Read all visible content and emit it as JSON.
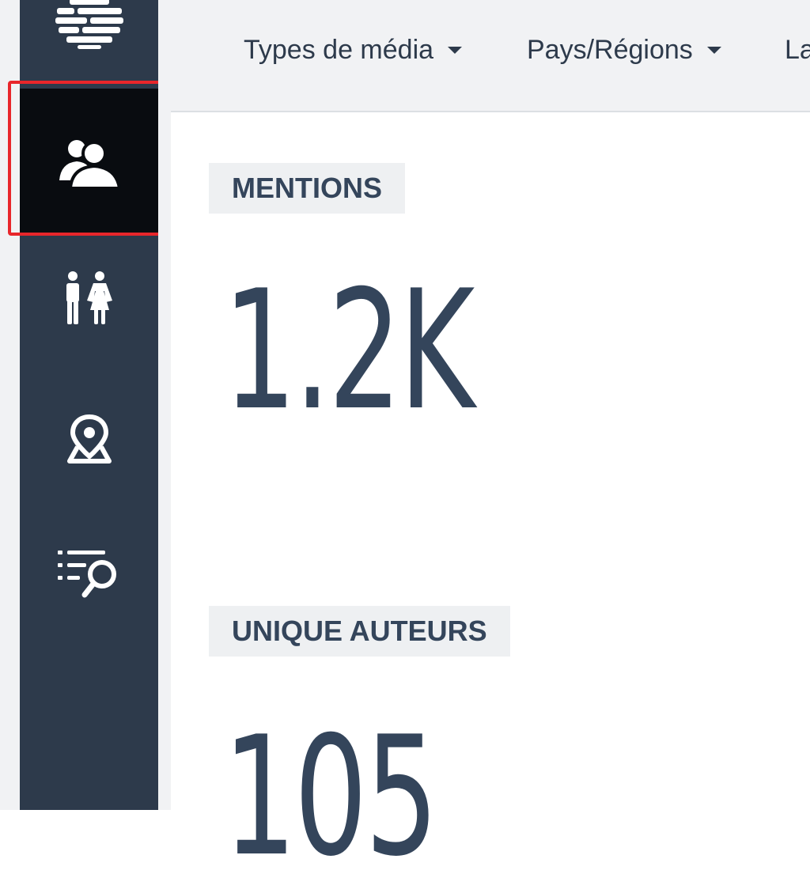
{
  "sidebar": {
    "items": [
      {
        "icon": "logo-icon"
      },
      {
        "icon": "audience-icon",
        "active": true
      },
      {
        "icon": "demographics-icon"
      },
      {
        "icon": "location-map-icon"
      },
      {
        "icon": "search-list-icon"
      }
    ],
    "active_background": "#090c10",
    "background": "#2d3a4b",
    "highlight_color": "#e8262b"
  },
  "topbar": {
    "filters": [
      {
        "label": "Types de média"
      },
      {
        "label": "Pays/Régions"
      },
      {
        "label": "La"
      }
    ]
  },
  "metrics": [
    {
      "label": "MENTIONS",
      "value": "1.2K"
    },
    {
      "label": "UNIQUE AUTEURS",
      "value": "105"
    }
  ]
}
